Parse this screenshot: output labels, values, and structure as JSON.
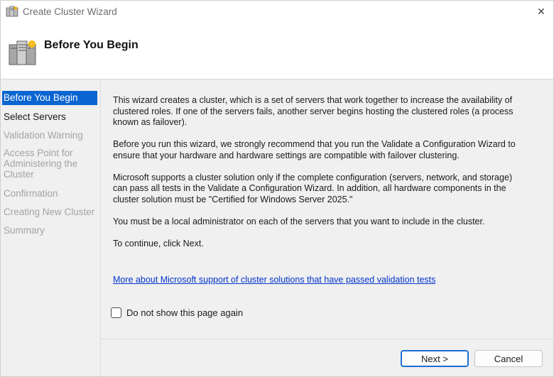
{
  "window": {
    "title": "Create Cluster Wizard",
    "close_glyph": "✕"
  },
  "header": {
    "title": "Before You Begin"
  },
  "nav": {
    "items": [
      {
        "label": "Before You Begin",
        "state": "active"
      },
      {
        "label": "Select Servers",
        "state": "enabled"
      },
      {
        "label": "Validation Warning",
        "state": "disabled"
      },
      {
        "label": "Access Point for Administering the Cluster",
        "state": "disabled"
      },
      {
        "label": "Confirmation",
        "state": "disabled"
      },
      {
        "label": "Creating New Cluster",
        "state": "disabled"
      },
      {
        "label": "Summary",
        "state": "disabled"
      }
    ]
  },
  "content": {
    "paragraphs": [
      "This wizard creates a cluster, which is a set of servers that work together to increase the availability of clustered roles. If one of the servers fails, another server begins hosting the clustered roles (a process known as failover).",
      "Before you run this wizard, we strongly recommend that you run the Validate a Configuration Wizard to ensure that your hardware and hardware settings are compatible with failover clustering.",
      "Microsoft supports a cluster solution only if the complete configuration (servers, network, and storage) can pass all tests in the Validate a Configuration Wizard. In addition, all hardware components in the cluster solution must be \"Certified for Windows Server 2025.\"",
      "You must be a local administrator on each of the servers that you want to include in the cluster.",
      "To continue, click Next."
    ],
    "link": "More about Microsoft support of cluster solutions that have passed validation tests"
  },
  "checkbox": {
    "label": "Do not show this page again",
    "checked": false
  },
  "buttons": {
    "next": "Next >",
    "cancel": "Cancel"
  },
  "colors": {
    "accent": "#0a64d2",
    "link": "#0033cc",
    "disabled_text": "#a3a3a3"
  },
  "icons": {
    "title": "cluster-server-icon",
    "header": "cluster-server-icon",
    "close": "close-icon"
  }
}
